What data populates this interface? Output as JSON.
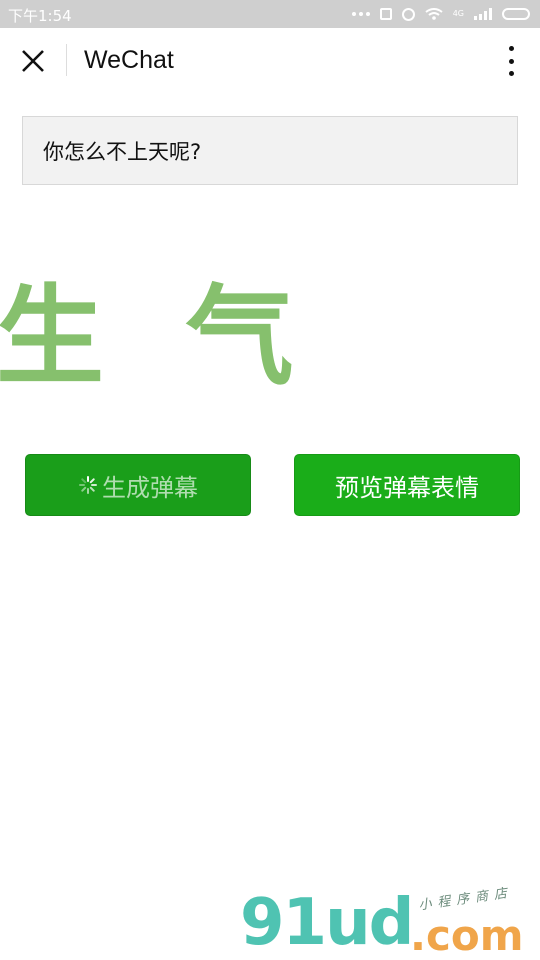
{
  "status_bar": {
    "time": "下午1:54",
    "network_label": "4G"
  },
  "nav": {
    "title": "WeChat"
  },
  "input": {
    "value": "你怎么不上天呢?"
  },
  "preview_text": "生 气",
  "buttons": {
    "generate_label": "生成弹幕",
    "preview_label": "预览弹幕表情"
  },
  "watermark": {
    "logo": "91ud",
    "domain": ".com",
    "tagline": "小程序商店"
  },
  "colors": {
    "accent": "#1aad19",
    "preview_text": "#86c06d",
    "status_bar": "#cfcfcf"
  }
}
